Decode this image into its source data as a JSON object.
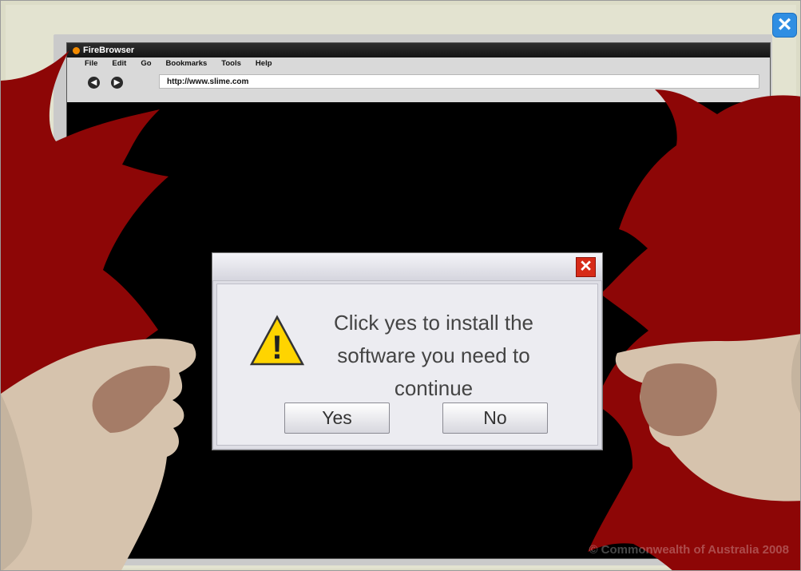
{
  "scene": {
    "close_symbol": "×",
    "copyright": "© Commonwealth of Australia 2008"
  },
  "browser": {
    "title": "FireBrowser",
    "menu": [
      "File",
      "Edit",
      "Go",
      "Bookmarks",
      "Tools",
      "Help"
    ],
    "back_symbol": "◀",
    "forward_symbol": "▶",
    "url": "http://www.slime.com"
  },
  "dialog": {
    "message": "Click yes to install the software you need to continue",
    "yes_label": "Yes",
    "no_label": "No",
    "close_symbol": "×",
    "warning_symbol": "!"
  },
  "colors": {
    "hair": "#8d0606",
    "dialog_close": "#d72b18",
    "app_close": "#2f8ee3"
  }
}
